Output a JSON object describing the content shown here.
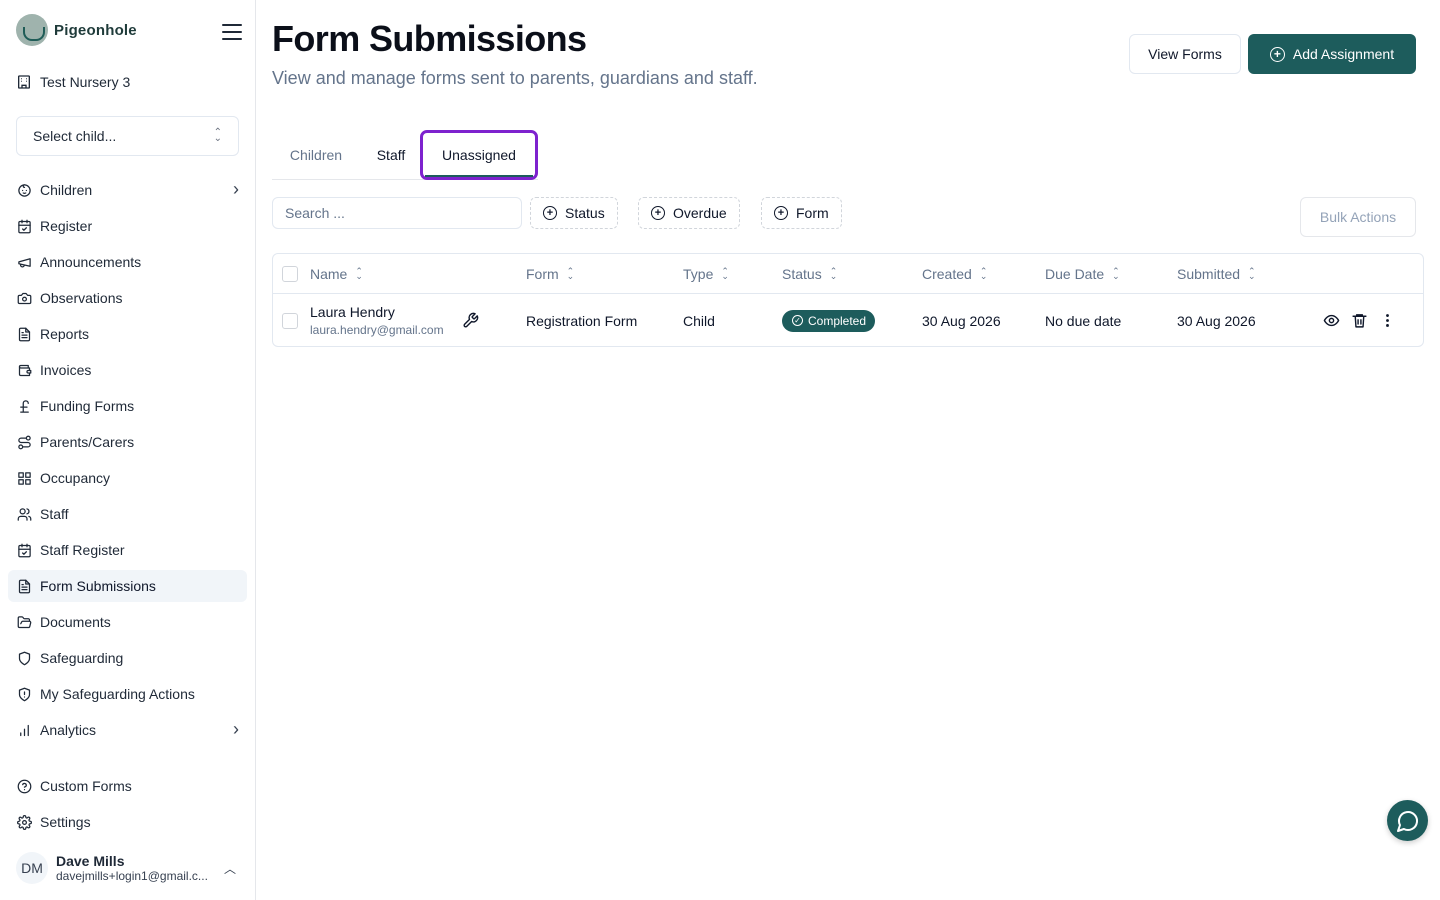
{
  "app": {
    "brand": "Pigeonhole",
    "nursery": "Test Nursery 3",
    "accent_color": "#1d5c5c",
    "focus_outline_color": "#7e22ce"
  },
  "sidebar": {
    "select_child": "Select child...",
    "items": [
      {
        "label": "Children",
        "icon": "baby-icon",
        "has_submenu": true
      },
      {
        "label": "Register",
        "icon": "calendar-check-icon"
      },
      {
        "label": "Announcements",
        "icon": "megaphone-icon"
      },
      {
        "label": "Observations",
        "icon": "camera-icon"
      },
      {
        "label": "Reports",
        "icon": "file-text-icon"
      },
      {
        "label": "Invoices",
        "icon": "wallet-icon"
      },
      {
        "label": "Funding Forms",
        "icon": "pound-sign-icon"
      },
      {
        "label": "Parents/Carers",
        "icon": "route-icon"
      },
      {
        "label": "Occupancy",
        "icon": "layout-grid-icon"
      },
      {
        "label": "Staff",
        "icon": "users-icon"
      },
      {
        "label": "Staff Register",
        "icon": "calendar-check-icon"
      },
      {
        "label": "Form Submissions",
        "icon": "file-text-icon",
        "active": true
      },
      {
        "label": "Documents",
        "icon": "folder-open-icon"
      },
      {
        "label": "Safeguarding",
        "icon": "shield-icon"
      },
      {
        "label": "My Safeguarding Actions",
        "icon": "shield-alert-icon"
      },
      {
        "label": "Analytics",
        "icon": "bar-chart-icon",
        "has_submenu": true
      }
    ],
    "bottom_items": [
      {
        "label": "Custom Forms",
        "icon": "help-circle-icon"
      },
      {
        "label": "Settings",
        "icon": "gear-icon"
      }
    ],
    "user": {
      "initials": "DM",
      "name": "Dave Mills",
      "email": "davejmills+login1@gmail.c..."
    }
  },
  "header": {
    "title": "Form Submissions",
    "subtitle": "View and manage forms sent to parents, guardians and staff.",
    "view_forms": "View Forms",
    "add_assignment": "Add Assignment"
  },
  "tabs": {
    "children": "Children",
    "staff": "Staff",
    "unassigned": "Unassigned",
    "active": "Unassigned"
  },
  "filters": {
    "search_placeholder": "Search ...",
    "status": "Status",
    "overdue": "Overdue",
    "form": "Form",
    "bulk_actions": "Bulk Actions"
  },
  "table": {
    "columns": [
      "Name",
      "Form",
      "Type",
      "Status",
      "Created",
      "Due Date",
      "Submitted"
    ],
    "rows": [
      {
        "name": "Laura Hendry",
        "email": "laura.hendry@gmail.com",
        "form": "Registration Form",
        "type": "Child",
        "status": "Completed",
        "created": "30 Aug 2026",
        "due_date": "No due date",
        "submitted": "30 Aug 2026"
      }
    ]
  }
}
